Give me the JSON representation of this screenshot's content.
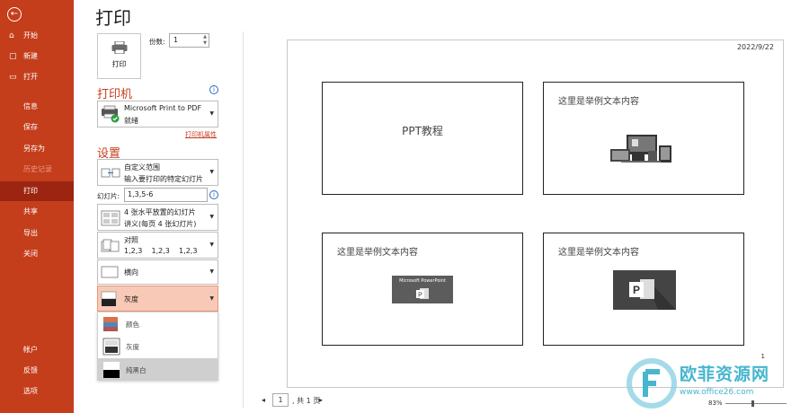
{
  "app": {
    "back_glyph": "←",
    "page_title": "打印"
  },
  "sidebar": {
    "items": [
      {
        "label": "开始",
        "icon": "home-icon",
        "glyph": "⌂"
      },
      {
        "label": "新建",
        "icon": "new-file-icon",
        "glyph": "▢"
      },
      {
        "label": "打开",
        "icon": "open-folder-icon",
        "glyph": "▭"
      },
      {
        "label": "信息"
      },
      {
        "label": "保存"
      },
      {
        "label": "另存为"
      },
      {
        "label": "历史记录"
      },
      {
        "label": "打印"
      },
      {
        "label": "共享"
      },
      {
        "label": "导出"
      },
      {
        "label": "关闭"
      },
      {
        "label": "帐户"
      },
      {
        "label": "反馈"
      },
      {
        "label": "选项"
      }
    ]
  },
  "print": {
    "button_label": "打印",
    "copies_label": "份数:",
    "copies_value": "1"
  },
  "printer": {
    "section_title": "打印机",
    "name": "Microsoft Print to PDF",
    "status": "就绪",
    "properties_link": "打印机属性"
  },
  "settings": {
    "section_title": "设置",
    "range": {
      "line1": "自定义范围",
      "line2": "输入要打印的特定幻灯片"
    },
    "slides_label": "幻灯片:",
    "slides_value": "1,3,5-6",
    "layout": {
      "line1": "4 张水平放置的幻灯片",
      "line2": "讲义(每页 4 张幻灯片)"
    },
    "collate": {
      "line1": "对照",
      "line2": "1,2,3    1,2,3    1,2,3"
    },
    "orientation": "横向",
    "color": "灰度",
    "color_options": [
      "颜色",
      "灰度",
      "纯黑白"
    ],
    "selected_option_index": 2
  },
  "preview": {
    "date": "2022/9/22",
    "page_number": "1",
    "slides": [
      {
        "center_text": "PPT教程"
      },
      {
        "text": "这里是举例文本内容"
      },
      {
        "text": "这里是举例文本内容",
        "logo_text": "Microsoft PowerPoint"
      },
      {
        "text": "这里是举例文本内容"
      }
    ]
  },
  "pager": {
    "current": "1",
    "total": ", 共 1 页",
    "prev": "◂",
    "next": "▸"
  },
  "zoom": {
    "level": "83%"
  },
  "watermark": {
    "text": "欧菲资源网",
    "url": "www.office26.com"
  },
  "colors": {
    "accent": "#c43e1c",
    "active_nav": "#9b2510",
    "link": "#c43e1c",
    "info": "#2b6ac0"
  }
}
